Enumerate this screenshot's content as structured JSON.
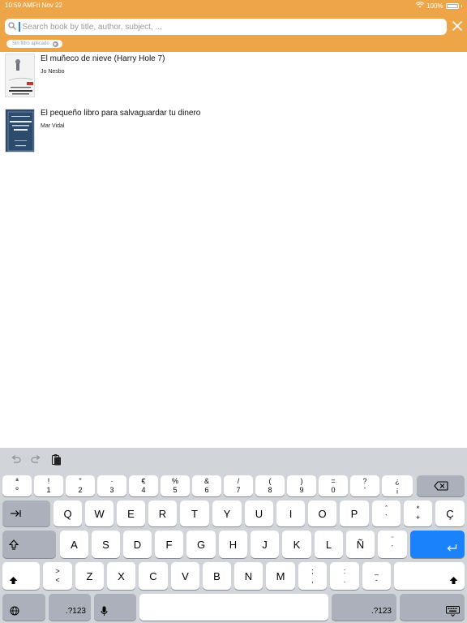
{
  "status_bar": {
    "time": "10:59 AM",
    "date": "Fri Nov 22",
    "battery": "100%"
  },
  "search": {
    "placeholder": "Search book by title, author, subject, ..."
  },
  "filter_chip": {
    "label": "Sin filtro aplicado"
  },
  "books": [
    {
      "title": "El muñeco de nieve (Harry Hole 7)",
      "author": "Jo Nesbo"
    },
    {
      "title": "El pequeño libro para salvaguardar tu dinero",
      "author": "Mar Vidal"
    }
  ],
  "keyboard": {
    "row1": [
      {
        "top": "ª",
        "bottom": "º"
      },
      {
        "top": "!",
        "bottom": "1"
      },
      {
        "top": "\"",
        "bottom": "2"
      },
      {
        "top": "·",
        "bottom": "3"
      },
      {
        "top": "€",
        "bottom": "4"
      },
      {
        "top": "%",
        "bottom": "5"
      },
      {
        "top": "&",
        "bottom": "6"
      },
      {
        "top": "/",
        "bottom": "7"
      },
      {
        "top": "(",
        "bottom": "8"
      },
      {
        "top": ")",
        "bottom": "9"
      },
      {
        "top": "=",
        "bottom": "0"
      },
      {
        "top": "?",
        "bottom": "'"
      },
      {
        "top": "¿",
        "bottom": "¡"
      }
    ],
    "row2": [
      "Q",
      "W",
      "E",
      "R",
      "T",
      "Y",
      "U",
      "I",
      "O",
      "P"
    ],
    "row2_extra": [
      {
        "top": "ˆ",
        "bottom": "`"
      },
      {
        "top": "*",
        "bottom": "+"
      },
      {
        "top": "",
        "bottom": "Ç"
      }
    ],
    "row3": [
      "A",
      "S",
      "D",
      "F",
      "G",
      "H",
      "J",
      "K",
      "L",
      "Ñ"
    ],
    "row3_extra": {
      "top": "¨",
      "bottom": "´"
    },
    "row4_left": {
      "top": ">",
      "bottom": "<"
    },
    "row4": [
      "Z",
      "X",
      "C",
      "V",
      "B",
      "N",
      "M"
    ],
    "row4_extra": [
      {
        "top": ";",
        "bottom": ","
      },
      {
        "top": ":",
        "bottom": "."
      },
      {
        "top": "_",
        "bottom": "-"
      }
    ],
    "numbers_label": ".?123",
    "accent_color": "#1a82fb",
    "header_color": "#eea547"
  }
}
